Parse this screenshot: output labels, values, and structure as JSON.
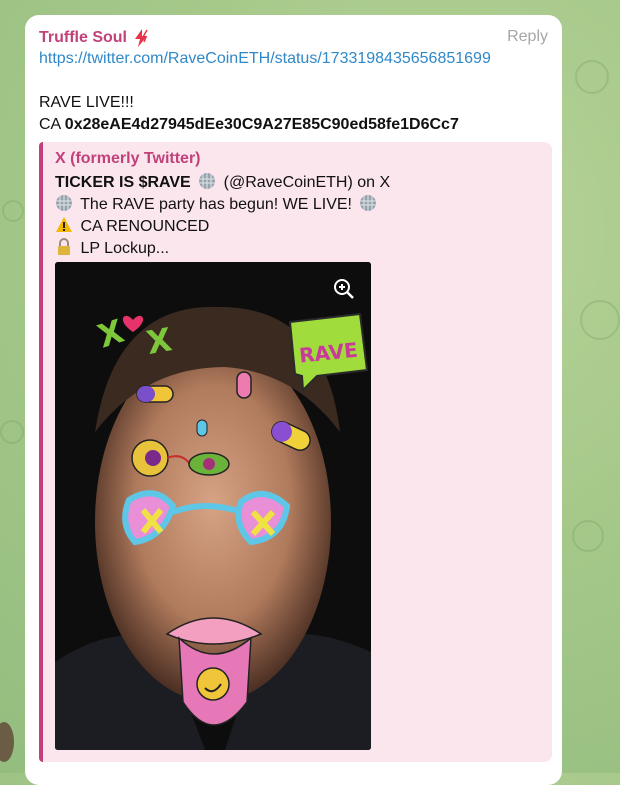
{
  "message": {
    "sender": "Truffle Soul",
    "reply_label": "Reply",
    "link": "https://twitter.com/RaveCoinETH/status/1733198435656851699",
    "line1": "RAVE LIVE!!!",
    "ca_prefix": "CA ",
    "ca_address": "0x28eAE4d27945dEe30C9A27E85C90ed58fe1D6Cc7"
  },
  "preview": {
    "source": "X (formerly Twitter)",
    "title_a": "TICKER IS $RAVE",
    "title_b": "(@RaveCoinETH) on X",
    "line1": "The RAVE party has begun! WE LIVE!",
    "line2": "CA RENOUNCED",
    "line3": "LP Lockup...",
    "image_text_rave": "RAVE"
  },
  "colors": {
    "accent": "#c2417a",
    "link": "#2f88c8",
    "preview_bg": "#fbe6ed",
    "chat_bg": "#a6c98a"
  },
  "icons": [
    "lightning-icon",
    "disco-ball-icon",
    "warning-icon",
    "lock-icon",
    "zoom-in-icon"
  ]
}
